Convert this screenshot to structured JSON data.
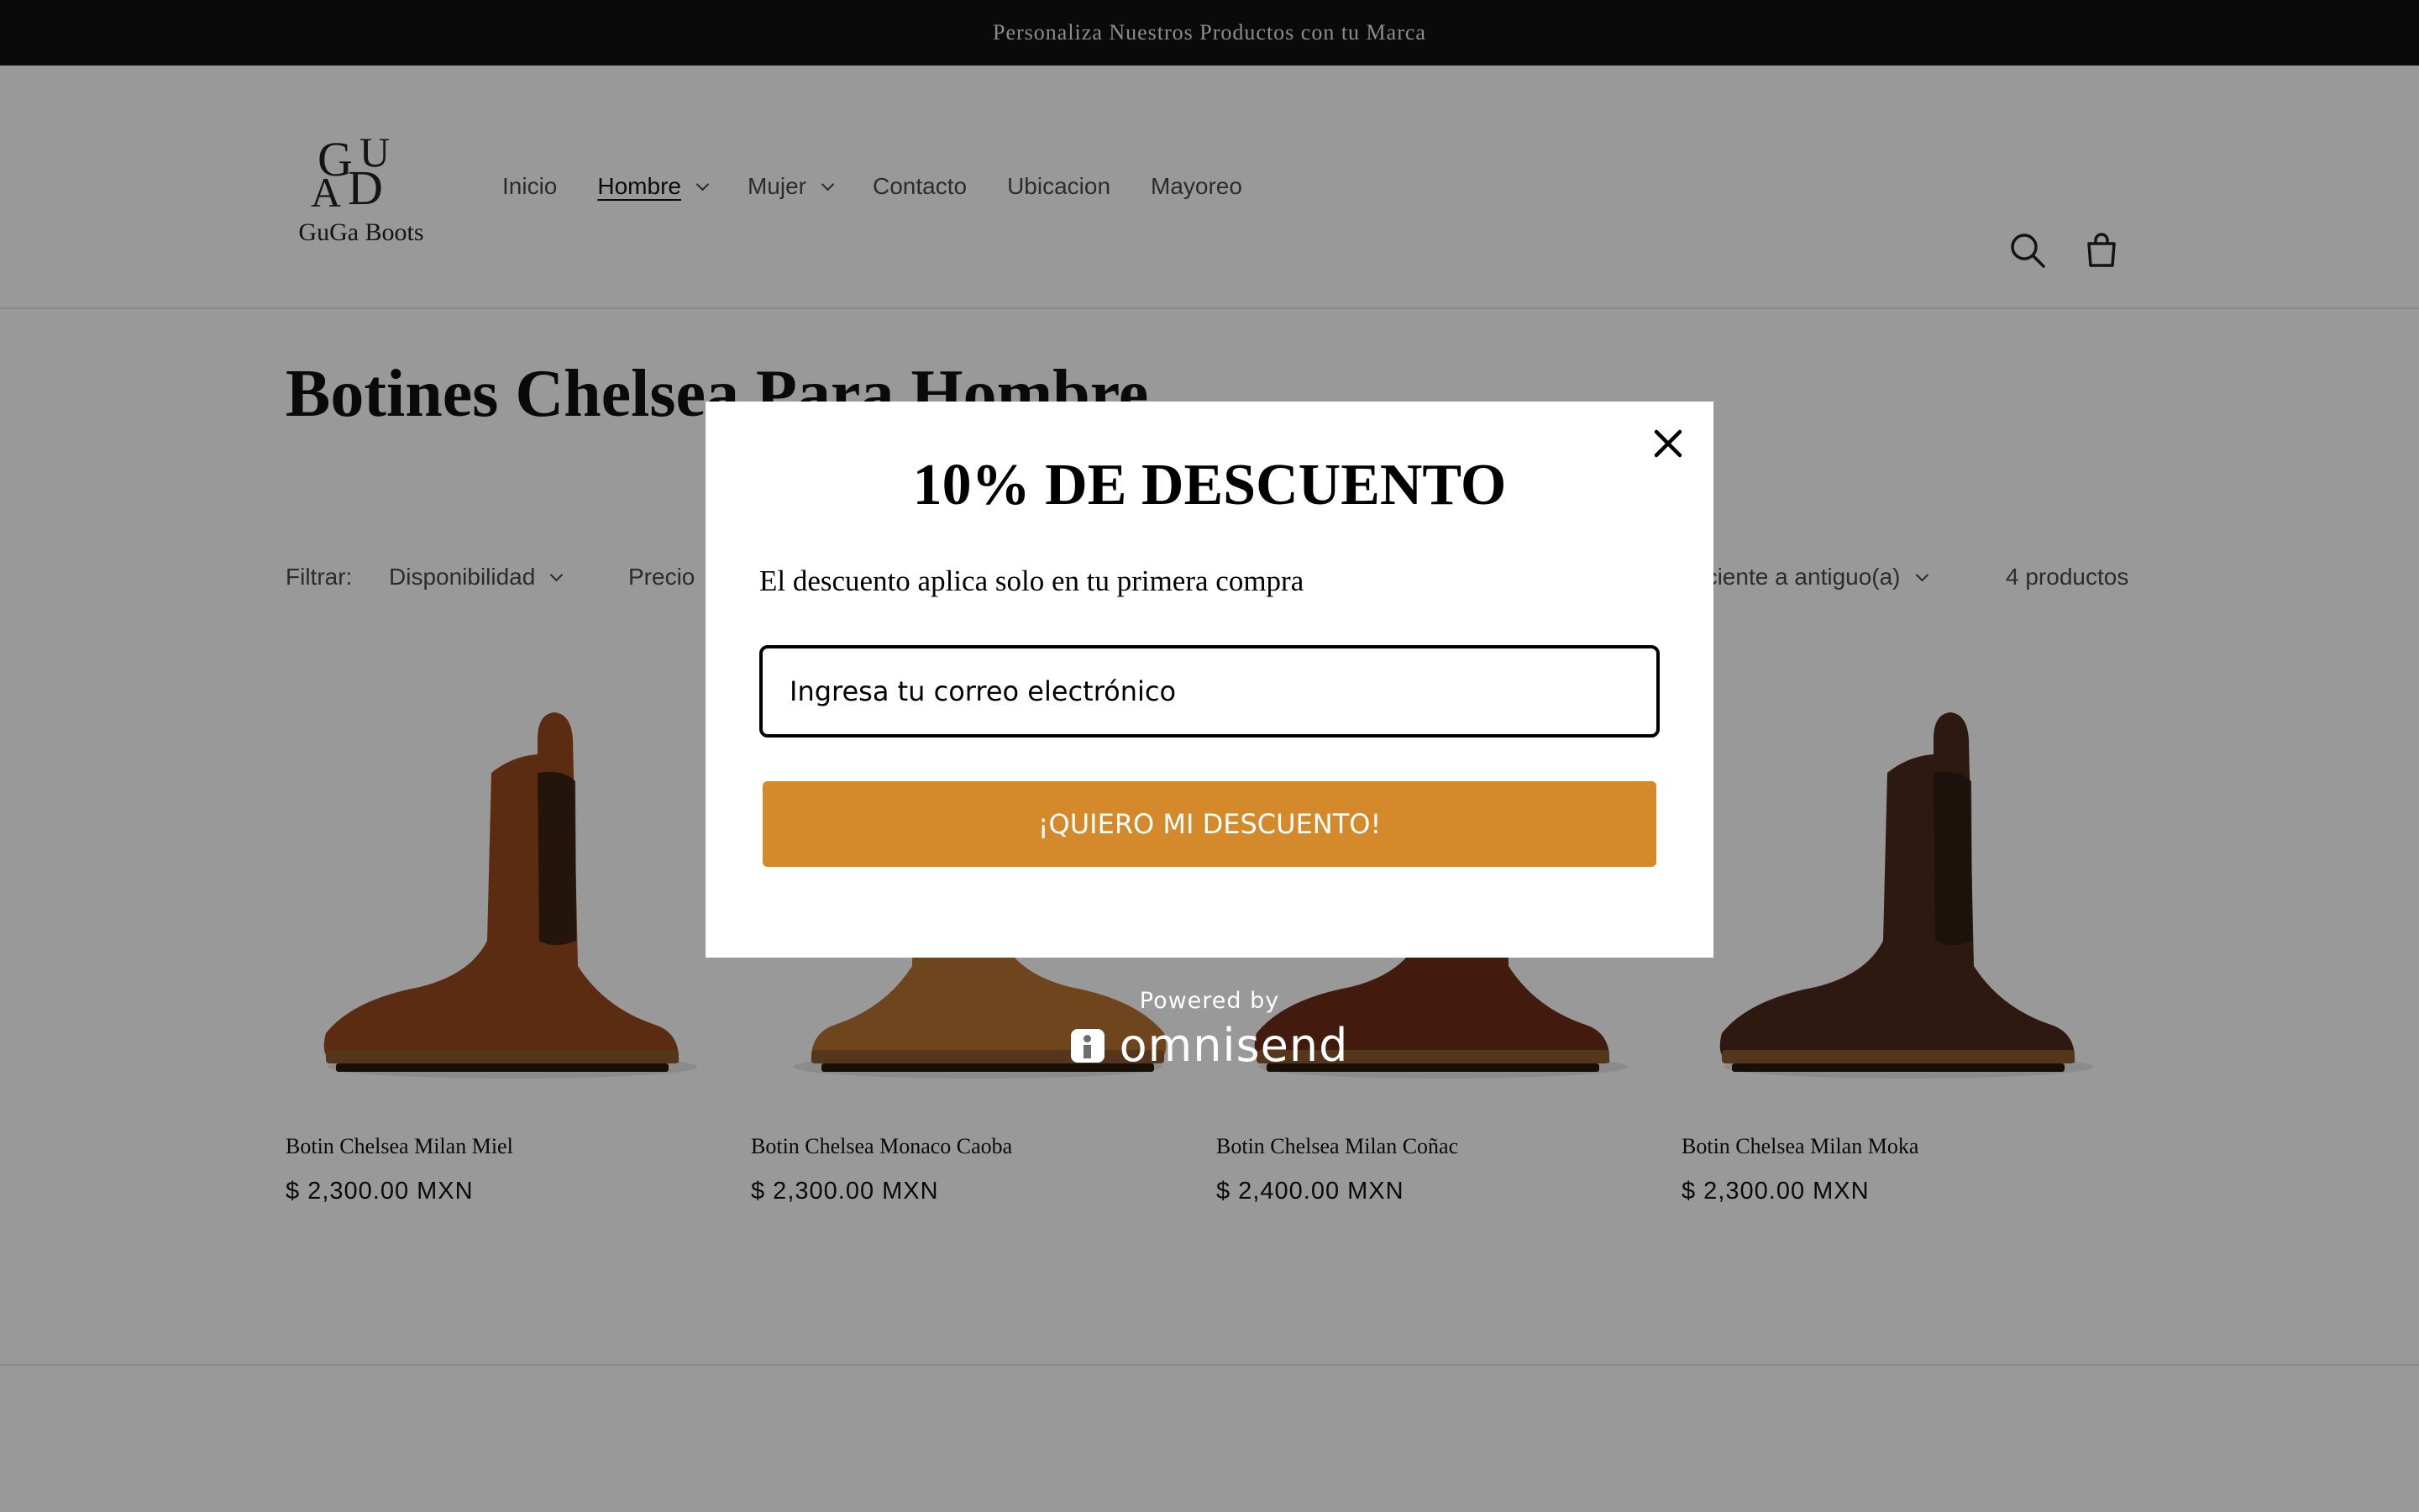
{
  "announcement": "Personaliza Nuestros Productos con tu Marca",
  "logo": {
    "monogram": [
      "G",
      "U",
      "A",
      "D"
    ],
    "name": "GuGa Boots"
  },
  "nav": {
    "items": [
      {
        "label": "Inicio",
        "dropdown": false,
        "active": false
      },
      {
        "label": "Hombre",
        "dropdown": true,
        "active": true
      },
      {
        "label": "Mujer",
        "dropdown": true,
        "active": false
      },
      {
        "label": "Contacto",
        "dropdown": false,
        "active": false
      },
      {
        "label": "Ubicacion",
        "dropdown": false,
        "active": false
      },
      {
        "label": "Mayoreo",
        "dropdown": false,
        "active": false
      }
    ],
    "icons": [
      "search-icon",
      "cart-icon"
    ]
  },
  "collection": {
    "title": "Botines Chelsea Para Hombre",
    "filter_label": "Filtrar:",
    "filters": [
      "Disponibilidad",
      "Precio"
    ],
    "sort_value": "eciente a antiguo(a)",
    "count": "4 productos"
  },
  "products": [
    {
      "name": "Botin Chelsea Milan Miel",
      "price": "$ 2,300.00 MXN",
      "color": "#9a4a1e"
    },
    {
      "name": "Botin Chelsea Monaco Caoba",
      "price": "$ 2,300.00 MXN",
      "color": "#b8742f"
    },
    {
      "name": "Botin Chelsea Milan Coñac",
      "price": "$ 2,400.00 MXN",
      "color": "#6e2e18"
    },
    {
      "name": "Botin Chelsea Milan Moka",
      "price": "$ 2,300.00 MXN",
      "color": "#4e2a1c"
    }
  ],
  "popup": {
    "title": "10% DE DESCUENTO",
    "subtitle": "El descuento aplica solo en tu primera compra",
    "email_placeholder": "Ingresa tu correo electrónico",
    "button_label": "¡QUIERO MI DESCUENTO!",
    "button_color": "#d4892a",
    "powered_by": "Powered by",
    "brand": "omnisend"
  }
}
